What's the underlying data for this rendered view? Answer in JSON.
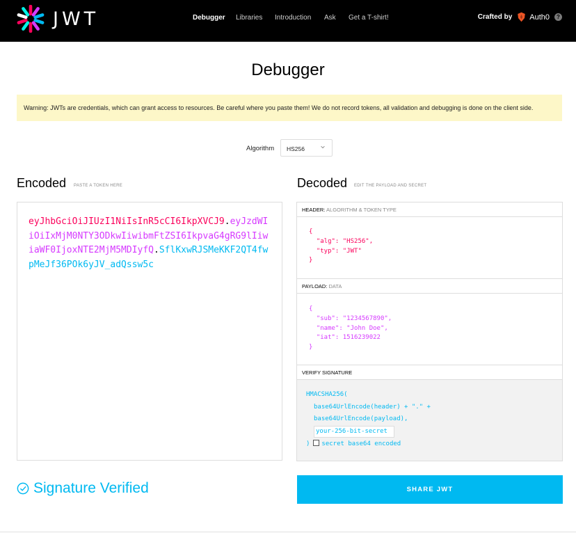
{
  "topbar": {
    "logo_text": "JWT",
    "nav": [
      {
        "label": "Debugger",
        "active": true
      },
      {
        "label": "Libraries",
        "active": false
      },
      {
        "label": "Introduction",
        "active": false
      },
      {
        "label": "Ask",
        "active": false
      },
      {
        "label": "Get a T-shirt!",
        "active": false
      }
    ],
    "crafted_by": "Crafted by",
    "brand": "Auth0",
    "help": "?"
  },
  "page_title": "Debugger",
  "warning": "Warning: JWTs are credentials, which can grant access to resources. Be careful where you paste them! We do not record tokens, all validation and debugging is done on the client side.",
  "algorithm": {
    "label": "Algorithm",
    "value": "HS256"
  },
  "encoded": {
    "title": "Encoded",
    "subtitle": "PASTE A TOKEN HERE",
    "token_header": "eyJhbGciOiJIUzI1NiIsInR5cCI6IkpXVCJ9",
    "token_payload": "eyJzdWIiOiIxMjM0NTY3ODkwIiwibmFtZSI6IkpvaG4gRG9lIiwiaWF0IjoxNTE2MjM5MDIyfQ",
    "token_signature": "SflKxwRJSMeKKF2QT4fwpMeJf36POk6yJV_adQssw5c",
    "dot": "."
  },
  "decoded": {
    "title": "Decoded",
    "subtitle": "EDIT THE PAYLOAD AND SECRET",
    "header_panel": {
      "label": "HEADER:",
      "sublabel": "ALGORITHM & TOKEN TYPE",
      "lines": [
        "{",
        "  \"alg\": \"HS256\",",
        "  \"typ\": \"JWT\"",
        "}"
      ]
    },
    "payload_panel": {
      "label": "PAYLOAD:",
      "sublabel": "DATA",
      "lines": [
        "{",
        "  \"sub\": \"1234567890\",",
        "  \"name\": \"John Doe\",",
        "  \"iat\": 1516239022",
        "}"
      ]
    },
    "verify_panel": {
      "label": "VERIFY SIGNATURE",
      "fn": "HMACSHA256(",
      "line1": "base64UrlEncode(header) + \".\" +",
      "line2": "base64UrlEncode(payload),",
      "secret_value": "your-256-bit-secret",
      "close": ")",
      "checkbox_label": "secret base64 encoded"
    }
  },
  "status": "Signature Verified",
  "share_button": "SHARE JWT",
  "colors": {
    "header": "#fb015b",
    "payload": "#d63aff",
    "signature": "#00b9f1",
    "warning_bg": "#fdf7c8"
  }
}
